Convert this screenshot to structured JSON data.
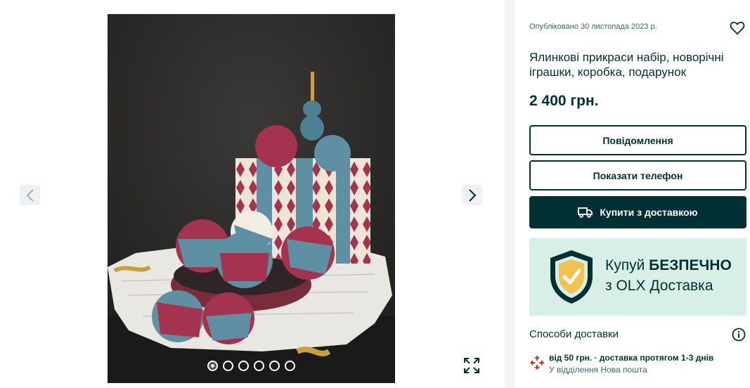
{
  "gallery": {
    "image_alt": "Ялинкові прикраси набір у коробці",
    "dots_count": 6,
    "active_dot": 0,
    "prev_icon": "chevron-left-icon",
    "next_icon": "chevron-right-icon",
    "fullscreen_icon": "expand-icon"
  },
  "listing": {
    "published": "Опубліковано 30 листопада 2023 р.",
    "title": "Ялинкові прикраси набір, новорічні іграшки, коробка, подарунок",
    "price": "2 400 грн.",
    "favorite_icon": "heart-icon"
  },
  "actions": {
    "message_label": "Повідомлення",
    "phone_label": "Показати телефон",
    "buy_label": "Купити з доставкою",
    "buy_icon": "truck-icon"
  },
  "banner": {
    "line1_prefix": "Купуй ",
    "line1_bold": "БЕЗПЕЧНО",
    "line2": "з OLX Доставка",
    "icon": "shield-check-icon"
  },
  "delivery": {
    "heading": "Способи доставки",
    "info_icon": "info-icon",
    "options": [
      {
        "logo": "nova-poshta-logo",
        "line1": "від 50 грн. · доставка протягом 1-3 днів",
        "line2": "У відділення Нова пошта"
      }
    ]
  },
  "colors": {
    "primary": "#002f34",
    "banner_bg": "#d8efe8",
    "np_red": "#da291c",
    "shield_gold": "#f2c14e"
  }
}
